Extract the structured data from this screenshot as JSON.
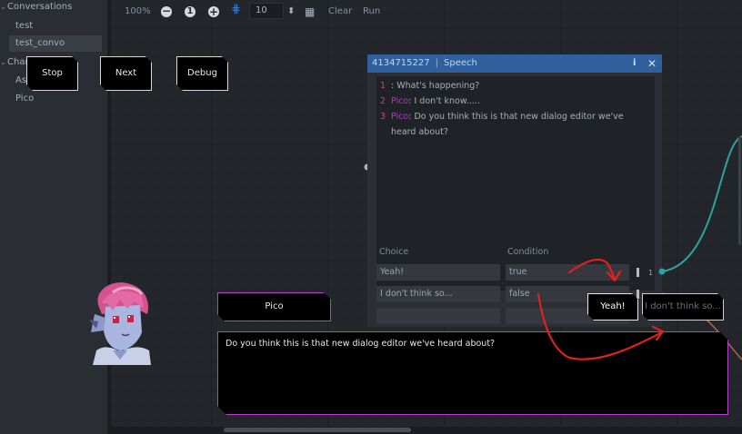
{
  "sidebar": {
    "conversations_header": "Conversations",
    "conversations": [
      "test",
      "test_convo"
    ],
    "characters_header": "Char",
    "characters": [
      "As",
      "Pico"
    ]
  },
  "toolbar": {
    "zoom": "100%",
    "zoom_reset": "1",
    "spin_value": "10",
    "clear_label": "Clear",
    "run_label": "Run"
  },
  "controls": {
    "stop": "Stop",
    "next": "Next",
    "debug": "Debug"
  },
  "node": {
    "id": "4134715227",
    "type": "Speech",
    "lines": [
      {
        "num": "1",
        "speaker": "",
        "text": ": What's happening?"
      },
      {
        "num": "2",
        "speaker": "Pico",
        "text": ": I don't know....."
      },
      {
        "num": "3",
        "speaker": "Pico",
        "text": ": Do you think this is that new dialog editor we've heard about?"
      }
    ],
    "choice_header": "Choice",
    "condition_header": "Condition",
    "choices": [
      {
        "choice": "Yeah!",
        "condition": "true",
        "port": "1"
      },
      {
        "choice": "I don't think so...",
        "condition": "false",
        "port": ""
      }
    ]
  },
  "dialog": {
    "speaker_name": "Pico",
    "text": "Do you think this is that new dialog editor we've heard about?",
    "choice_true": "Yeah!",
    "choice_false": "I don't think so..."
  },
  "colors": {
    "accent_speaker": "#b235c9",
    "dialog_border": "#c23ad6",
    "node_header": "#2f5f9c",
    "connection": "#2aa3a6",
    "annotation_arrow": "#e0211d"
  }
}
